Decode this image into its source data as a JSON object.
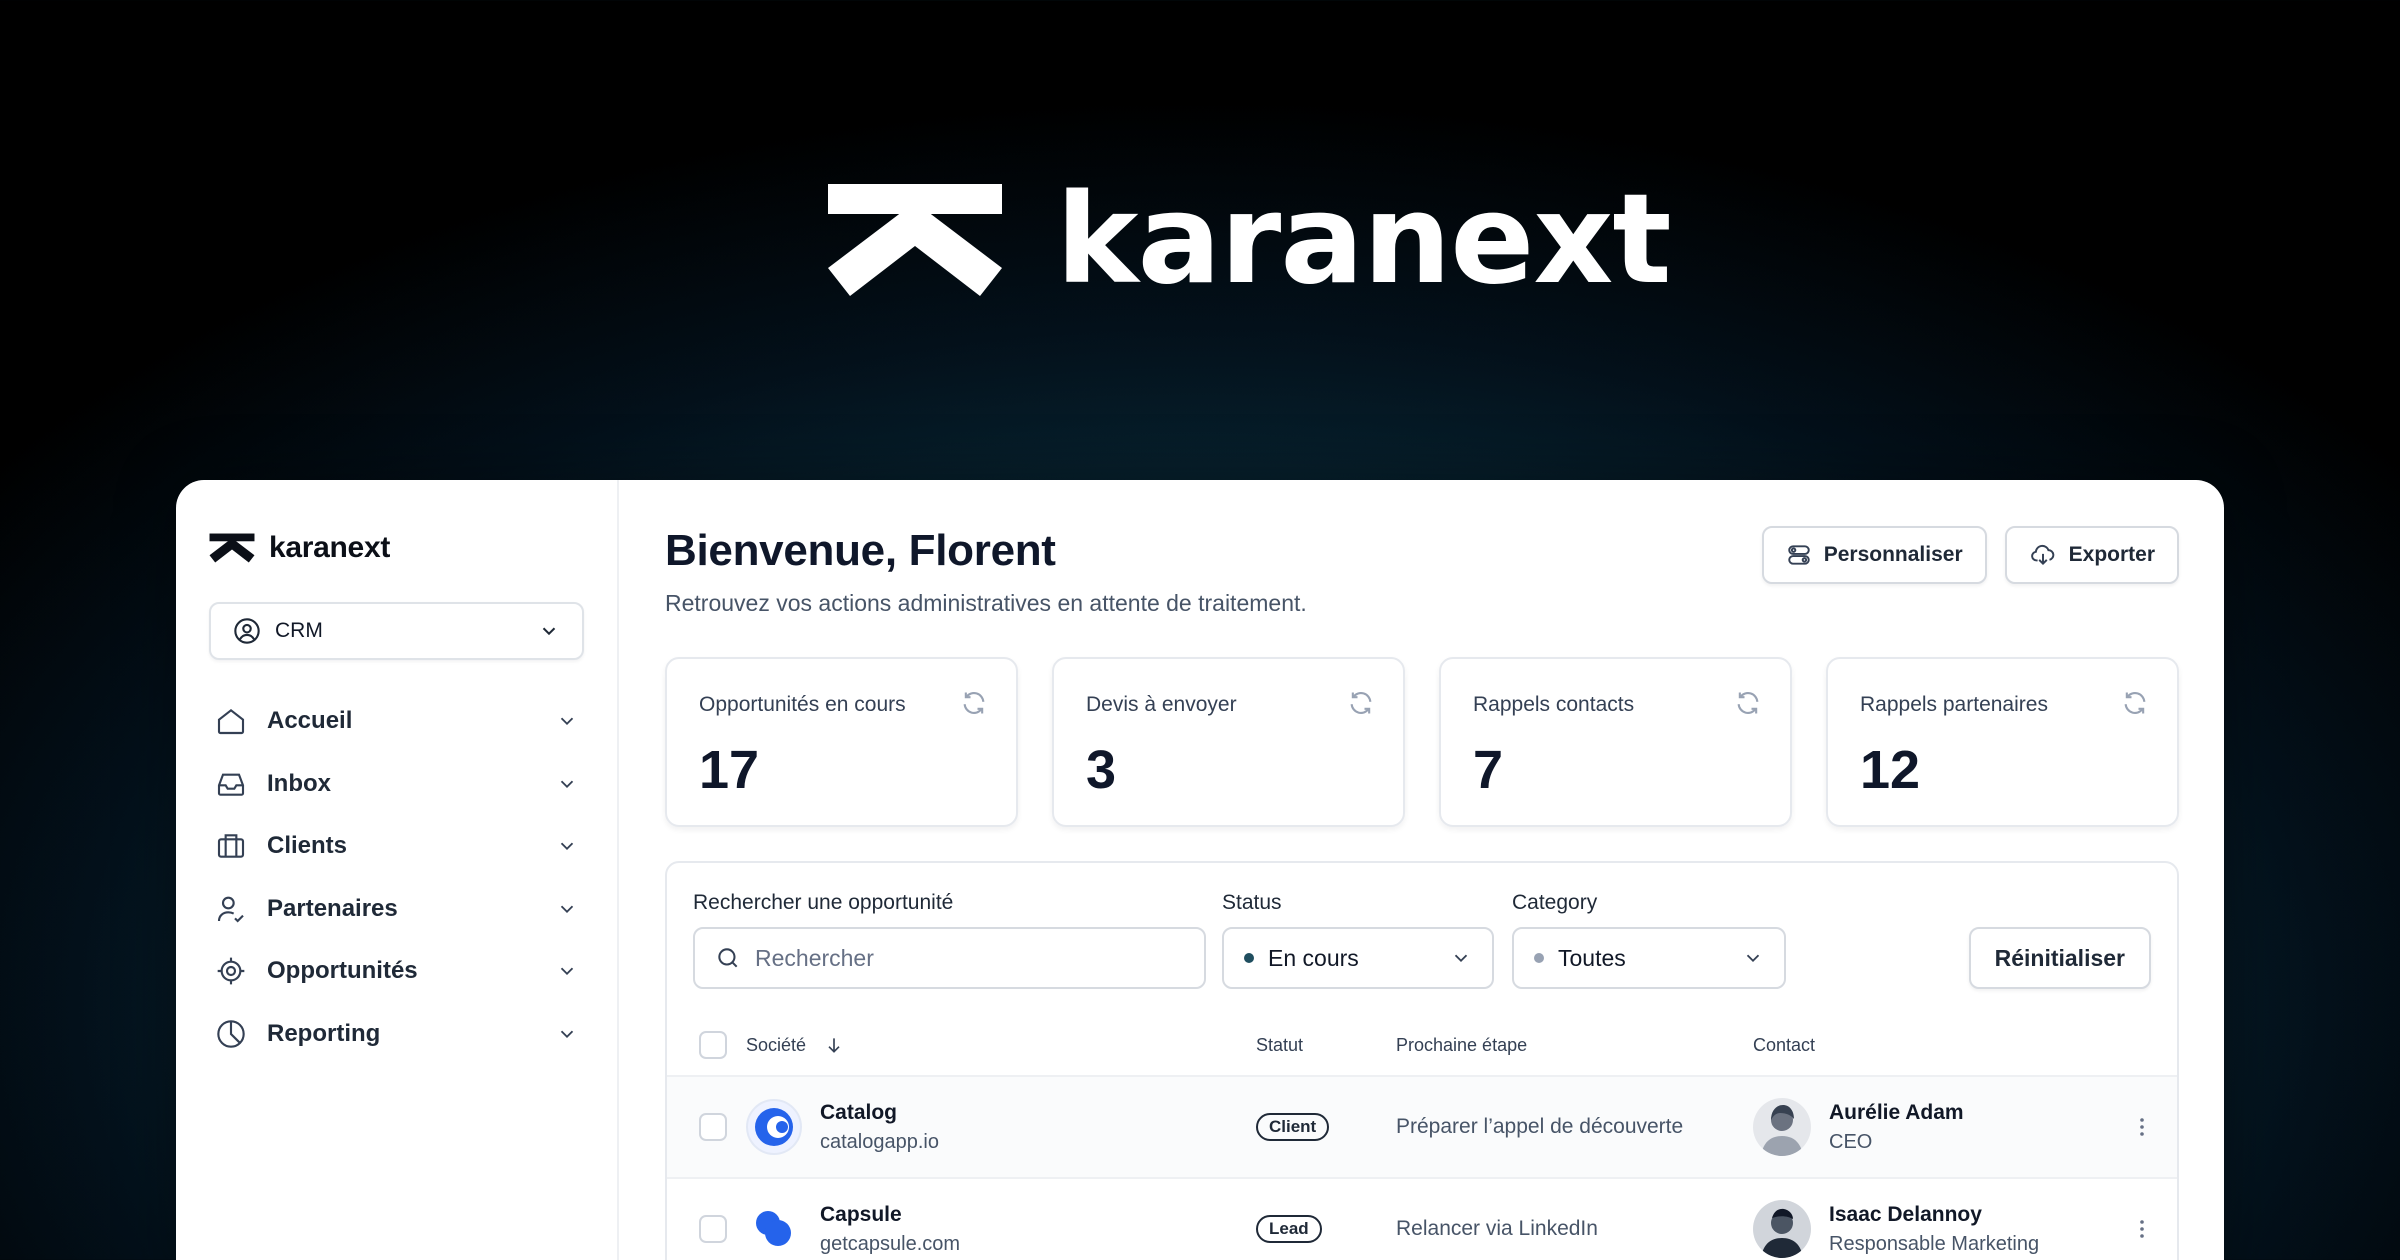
{
  "hero": {
    "brand_name": "karanext"
  },
  "sidebar": {
    "brand_name": "karanext",
    "module_select": {
      "value": "CRM"
    },
    "items": [
      {
        "label": "Accueil",
        "icon": "home-icon"
      },
      {
        "label": "Inbox",
        "icon": "inbox-icon"
      },
      {
        "label": "Clients",
        "icon": "briefcase-icon"
      },
      {
        "label": "Partenaires",
        "icon": "user-check-icon"
      },
      {
        "label": "Opportunités",
        "icon": "target-icon"
      },
      {
        "label": "Reporting",
        "icon": "pie-chart-icon"
      }
    ]
  },
  "header": {
    "title": "Bienvenue, Florent",
    "subtitle": "Retrouvez vos actions administratives en attente de traitement.",
    "customize_label": "Personnaliser",
    "export_label": "Exporter"
  },
  "stats": [
    {
      "label": "Opportunités en cours",
      "value": "17"
    },
    {
      "label": "Devis à envoyer",
      "value": "3"
    },
    {
      "label": "Rappels contacts",
      "value": "7"
    },
    {
      "label": "Rappels partenaires",
      "value": "12"
    }
  ],
  "filters": {
    "search_label": "Rechercher une opportunité",
    "search_placeholder": "Rechercher",
    "status_label": "Status",
    "status_value": "En cours",
    "category_label": "Category",
    "category_value": "Toutes",
    "reset_label": "Réinitialiser"
  },
  "table": {
    "columns": {
      "company": "Société",
      "status": "Statut",
      "next_step": "Prochaine étape",
      "contact": "Contact"
    },
    "rows": [
      {
        "company": "Catalog",
        "domain": "catalogapp.io",
        "status": "Client",
        "next_step": "Préparer l’appel de découverte",
        "contact_name": "Aurélie Adam",
        "contact_role": "CEO"
      },
      {
        "company": "Capsule",
        "domain": "getcapsule.com",
        "status": "Lead",
        "next_step": "Relancer via LinkedIn",
        "contact_name": "Isaac Delannoy",
        "contact_role": "Responsable Marketing"
      }
    ]
  },
  "colors": {
    "accent_blue": "#2563eb",
    "status_dot": "#1f4e5f",
    "neutral_dot": "#98a2b3"
  }
}
